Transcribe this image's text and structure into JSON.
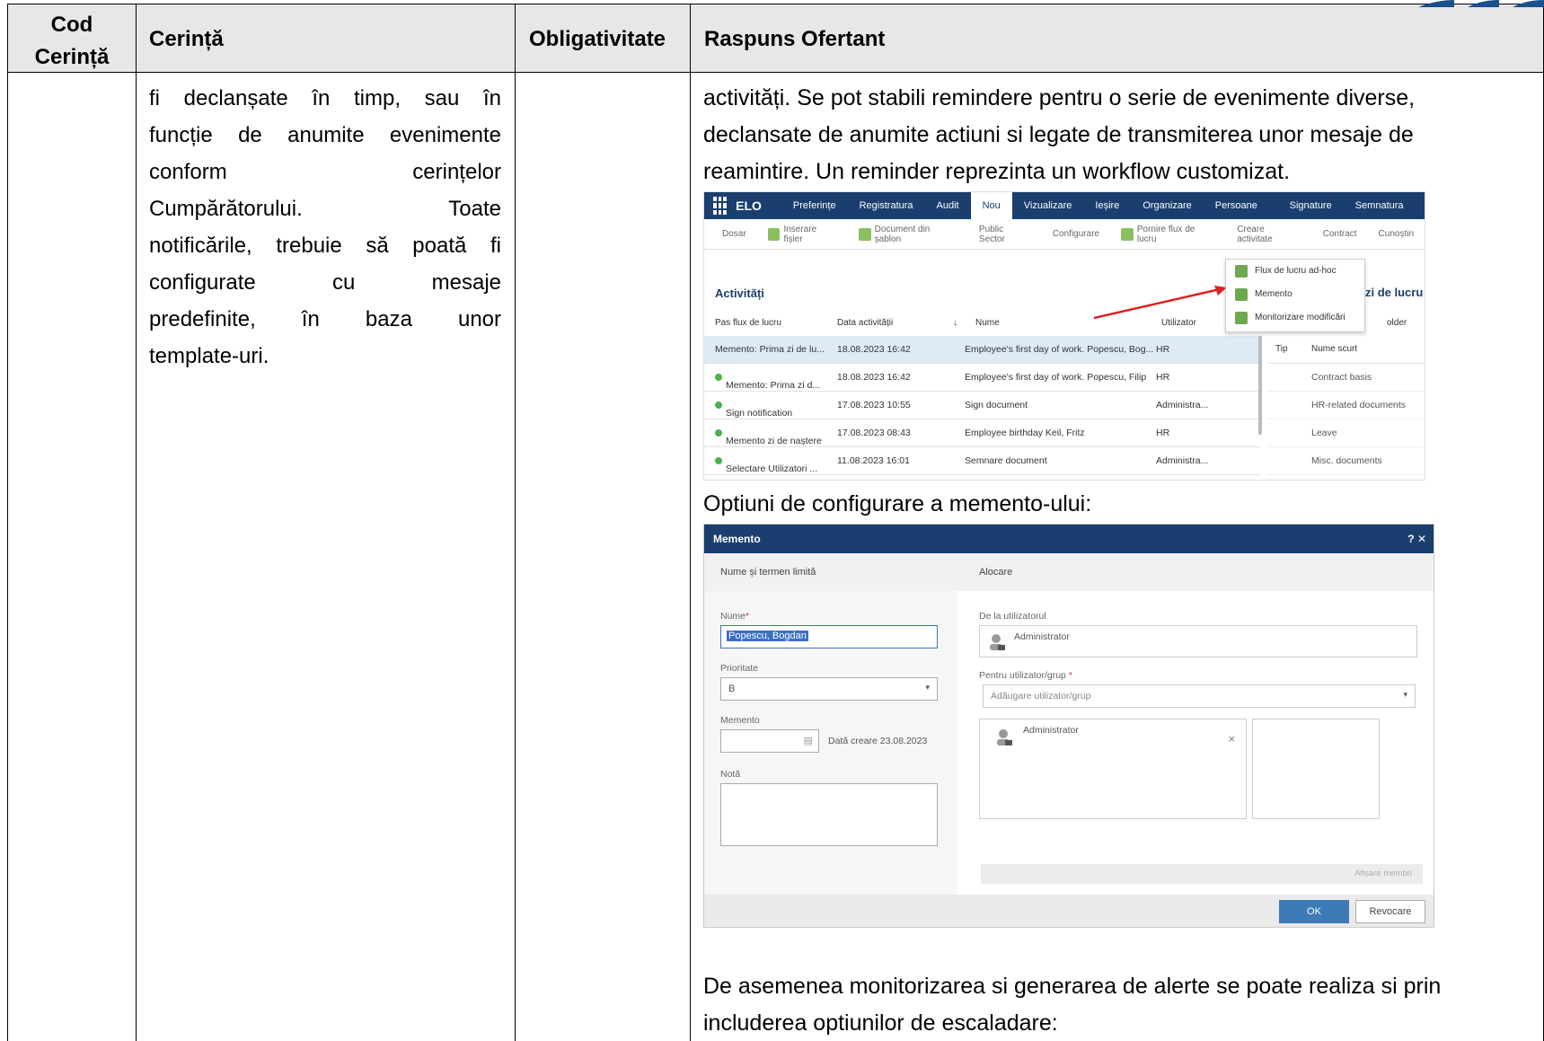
{
  "header": {
    "col1_line1": "Cod",
    "col1_line2": "Cerință",
    "col2": "Cerință",
    "col3": "Obligativitate",
    "col4": "Raspuns Ofertant"
  },
  "requirement_lines": [
    "fi declanșate în timp, sau în",
    "funcție de anumite evenimente",
    "conform cerințelor",
    "Cumpărătorului. Toate",
    "notificările, trebuie să poată fi",
    "configurate cu mesaje",
    "predefinite, în baza unor",
    "template-uri."
  ],
  "response": {
    "line1": "activități. Se pot stabili remindere pentru o serie de evenimente diverse,",
    "line2": "declansate de anumite actiuni si legate de transmiterea unor mesaje de",
    "line3": "reamintire. Un reminder reprezinta un workflow customizat.",
    "caption2": "Optiuni de configurare a memento-ului:",
    "para_line1": "De asemenea monitorizarea si generarea de alerte se poate realiza si prin",
    "para_line2": "includerea optiunilor de escaladare:"
  },
  "shot1": {
    "brand": "ELO",
    "menu": [
      "Preferințe",
      "Registratura",
      "Audit",
      "Nou",
      "Vizualizare",
      "Ieșire",
      "Organizare",
      "Persoane fizice",
      "Signature",
      "Semnatura Electr"
    ],
    "toolbar": [
      "Dosar",
      "Inserare fișier",
      "Document din șablon",
      "Public Sector",
      "Configurare",
      "Pornire flux de lucru",
      "Creare activitate",
      "Contract",
      "Cunoștin"
    ],
    "section_title": "Activități",
    "side_title": "zi de lucru",
    "columns": [
      "Pas flux de lucru",
      "Data activității",
      "Nume",
      "Utilizator"
    ],
    "rows": [
      {
        "step": "Memento: Prima zi de lu...",
        "date": "18.08.2023 16:42",
        "name": "Employee's first day of work. Popescu, Bog...",
        "user": "HR"
      },
      {
        "step": "Memento: Prima zi d...",
        "date": "18.08.2023 16:42",
        "name": "Employee's first day of work. Popescu, Filip",
        "user": "HR"
      },
      {
        "step": "Sign notification",
        "date": "17.08.2023 10:55",
        "name": "Sign document",
        "user": "Administra..."
      },
      {
        "step": "Memento zi de naștere",
        "date": "17.08.2023 08:43",
        "name": "Employee birthday Keil, Fritz",
        "user": "HR"
      },
      {
        "step": "Selectare Utilizatori ...",
        "date": "11.08.2023 16:01",
        "name": "Semnare document",
        "user": "Administra..."
      }
    ],
    "dropdown": [
      "Flux de lucru ad-hoc",
      "Memento",
      "Monitorizare modificări"
    ],
    "side_header": [
      "Tip",
      "Nume scurt",
      "older"
    ],
    "side_rows": [
      "Contract basis",
      "HR-related documents",
      "Leave",
      "Misc. documents"
    ]
  },
  "shot2": {
    "title": "Memento",
    "controls": "?  ✕",
    "section_left": "Nume și termen limită",
    "section_right": "Alocare",
    "name_label": "Nume",
    "name_value": "Popescu, Bogdan",
    "priority_label": "Prioritate",
    "priority_value": "B",
    "memento_label": "Memento",
    "creation_date": "Dată creare 23.08.2023",
    "note_label": "Notă",
    "from_user_label": "De la utilizatorul",
    "from_user_value": "Administrator",
    "for_user_label": "Pentru utilizator/grup",
    "add_user_placeholder": "Adăugare utilizator/grup",
    "assigned_user": "Administrator",
    "show_members": "Afișare membri",
    "ok": "OK",
    "cancel": "Revocare"
  }
}
